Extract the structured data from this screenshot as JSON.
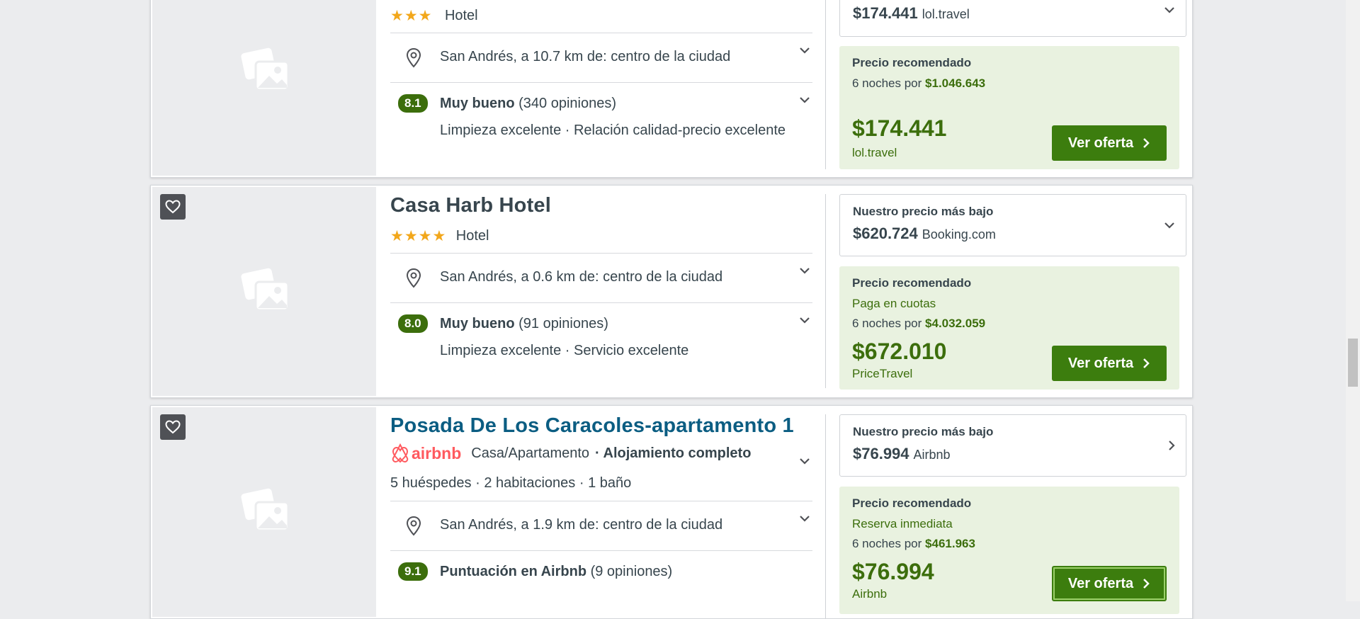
{
  "hotels": [
    {
      "stars": 3,
      "type": "Hotel",
      "location": "San Andrés, a 10.7 km de: centro de la ciudad",
      "score": "8.1",
      "rating_word": "Muy bueno",
      "reviews": "(340 opiniones)",
      "highlights": "Limpieza excelente · Relación calidad-precio excelente",
      "lowest": {
        "price": "$174.441",
        "provider": "lol.travel"
      },
      "recommended": {
        "label": "Precio recomendado",
        "nights": "6 noches por",
        "total": "$1.046.643",
        "price": "$174.441",
        "provider": "lol.travel",
        "button": "Ver oferta"
      }
    },
    {
      "name": "Casa Harb Hotel",
      "stars": 4,
      "type": "Hotel",
      "location": "San Andrés, a 0.6 km de: centro de la ciudad",
      "score": "8.0",
      "rating_word": "Muy bueno",
      "reviews": "(91 opiniones)",
      "highlights": "Limpieza excelente · Servicio excelente",
      "lowest": {
        "label": "Nuestro precio más bajo",
        "price": "$620.724",
        "provider": "Booking.com"
      },
      "recommended": {
        "label": "Precio recomendado",
        "tag": "Paga en cuotas",
        "nights": "6 noches por",
        "total": "$4.032.059",
        "price": "$672.010",
        "provider": "PriceTravel",
        "button": "Ver oferta"
      }
    },
    {
      "name": "Posada De Los Caracoles-apartamento 1",
      "brand": "airbnb",
      "type": "Casa/Apartamento",
      "type_extra": "· Alojamiento completo",
      "details": "5 huéspedes · 2 habitaciones · 1 baño",
      "location": "San Andrés, a 1.9 km de: centro de la ciudad",
      "score": "9.1",
      "rating_word": "Puntuación en Airbnb",
      "reviews": "(9 opiniones)",
      "lowest": {
        "label": "Nuestro precio más bajo",
        "price": "$76.994",
        "provider": "Airbnb"
      },
      "recommended": {
        "label": "Precio recomendado",
        "tag": "Reserva inmediata",
        "nights": "6 noches por",
        "total": "$461.963",
        "price": "$76.994",
        "provider": "Airbnb",
        "button": "Ver oferta"
      }
    }
  ],
  "colors": {
    "accent_green": "#3c7d0e",
    "score_green": "#3c6e0c",
    "link_blue": "#0b5d82",
    "star_gold": "#f2a71b"
  },
  "icons": [
    "heart-icon",
    "image-placeholder-icon",
    "map-pin-icon",
    "chevron-down-icon",
    "chevron-right-icon",
    "airbnb-logo-icon"
  ]
}
